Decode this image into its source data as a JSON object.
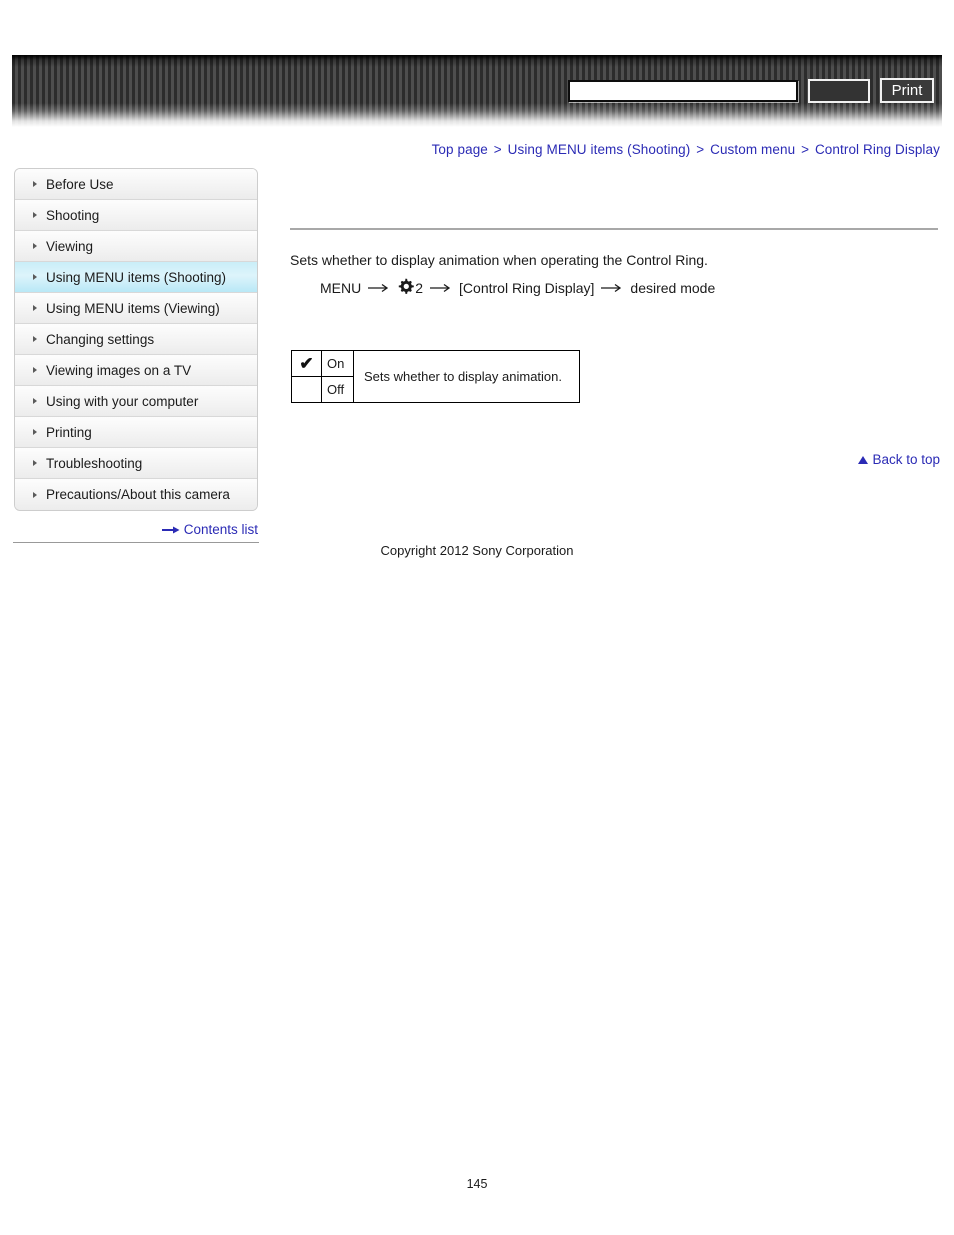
{
  "header": {
    "search": {
      "value": "",
      "placeholder": ""
    },
    "search_button_label": "",
    "print_button_label": "Print"
  },
  "breadcrumb": {
    "separator": ">",
    "items": [
      {
        "label": "Top page"
      },
      {
        "label": "Using MENU items (Shooting)"
      },
      {
        "label": "Custom menu"
      },
      {
        "label": "Control Ring Display"
      }
    ]
  },
  "sidebar": {
    "items": [
      {
        "label": "Before Use",
        "active": false
      },
      {
        "label": "Shooting",
        "active": false
      },
      {
        "label": "Viewing",
        "active": false
      },
      {
        "label": "Using MENU items (Shooting)",
        "active": true
      },
      {
        "label": "Using MENU items (Viewing)",
        "active": false
      },
      {
        "label": "Changing settings",
        "active": false
      },
      {
        "label": "Viewing images on a TV",
        "active": false
      },
      {
        "label": "Using with your computer",
        "active": false
      },
      {
        "label": "Printing",
        "active": false
      },
      {
        "label": "Troubleshooting",
        "active": false
      },
      {
        "label": "Precautions/About this camera",
        "active": false
      }
    ],
    "contents_list_label": "Contents list"
  },
  "main": {
    "intro_text": "Sets whether to display animation when operating the Control Ring.",
    "menu_path": {
      "start_label": "MENU",
      "arrow": "→",
      "custom_menu_number": "2",
      "item_label": "[Control Ring Display]",
      "end_label": "desired mode"
    },
    "options_table": {
      "rows": [
        {
          "checked": true,
          "check_glyph": "✔",
          "option": "On"
        },
        {
          "checked": false,
          "check_glyph": "",
          "option": "Off"
        }
      ],
      "description": "Sets whether to display animation."
    }
  },
  "footer": {
    "back_to_top_label": "Back to top",
    "copyright": "Copyright 2012 Sony Corporation",
    "page_number": "145"
  },
  "colors": {
    "link": "#2b2bb5",
    "active_nav": "#c9eef8",
    "rule": "#a8a8a8"
  }
}
